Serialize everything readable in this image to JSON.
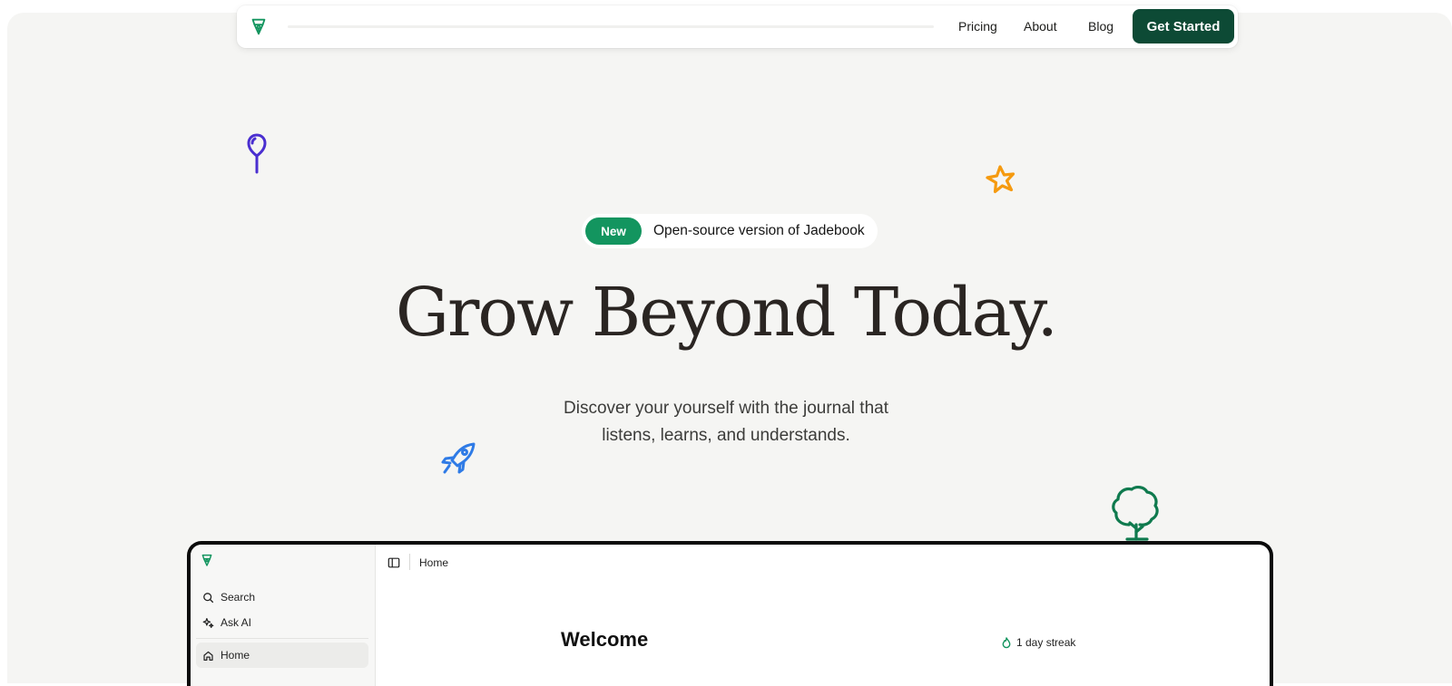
{
  "colors": {
    "brand_dark": "#0d4a35",
    "brand": "#13955f",
    "hero_bg": "#f5f5f3",
    "headline": "#2a2522",
    "balloon": "#4a2fd0",
    "star": "#f59a0f",
    "rocket": "#2f7be6",
    "tree": "#0f7a4e"
  },
  "navbar": {
    "logo_icon": "pen-nib-icon",
    "links": [
      "Pricing",
      "About",
      "Blog"
    ],
    "cta": "Get Started"
  },
  "decorations": [
    "balloon-icon",
    "star-icon",
    "rocket-icon",
    "tree-icon"
  ],
  "badge": {
    "tag": "New",
    "text": "Open-source version of Jadebook"
  },
  "hero": {
    "headline": "Grow Beyond Today.",
    "subheadline_line1": "Discover your yourself with the journal that",
    "subheadline_line2": "listens, learns, and understands."
  },
  "app_preview": {
    "sidebar": {
      "items": [
        {
          "label": "Search",
          "icon": "search-icon"
        },
        {
          "label": "Ask AI",
          "icon": "sparkle-icon"
        },
        {
          "label": "Home",
          "icon": "home-icon",
          "active": true
        }
      ]
    },
    "topbar": {
      "toggle_icon": "sidebar-toggle-icon",
      "title": "Home"
    },
    "main": {
      "welcome": "Welcome",
      "streak": "1 day streak",
      "streak_icon": "flame-icon"
    }
  }
}
